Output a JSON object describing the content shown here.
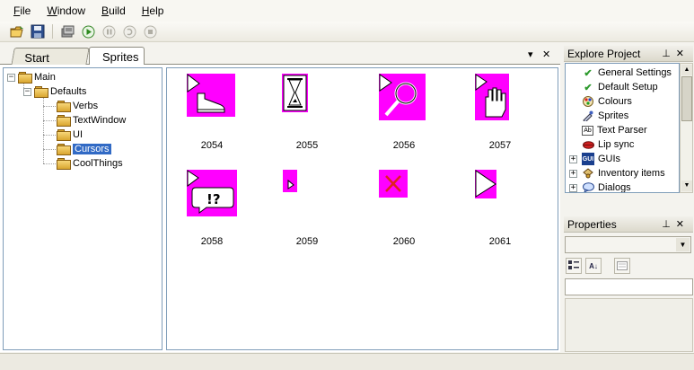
{
  "menu": {
    "items": [
      "File",
      "Window",
      "Build",
      "Help"
    ],
    "hotkeys": [
      "F",
      "W",
      "B",
      "H"
    ]
  },
  "toolbar": {
    "icons": [
      "open-folder-icon",
      "save-icon",
      "build-icon",
      "run-icon",
      "pause-icon",
      "step-icon",
      "stop-icon"
    ]
  },
  "tabs": {
    "start_page": "Start Page",
    "sprites": "Sprites",
    "dropdown_glyph": "▾",
    "close_glyph": "✕"
  },
  "tree": {
    "main": "Main",
    "defaults": "Defaults",
    "children": [
      "Verbs",
      "TextWindow",
      "UI",
      "Cursors",
      "CoolThings"
    ],
    "selected": "Cursors"
  },
  "sprites": [
    {
      "id": "2054",
      "icon": "shoe-walk-cursor-icon"
    },
    {
      "id": "2055",
      "icon": "hourglass-wait-cursor-icon"
    },
    {
      "id": "2056",
      "icon": "magnifier-look-cursor-icon"
    },
    {
      "id": "2057",
      "icon": "hand-interact-cursor-icon"
    },
    {
      "id": "2058",
      "icon": "speech-bubble-talk-cursor-icon"
    },
    {
      "id": "2059",
      "icon": "small-arrow-cursor-icon"
    },
    {
      "id": "2060",
      "icon": "red-x-cursor-icon"
    },
    {
      "id": "2061",
      "icon": "arrow-cursor-icon"
    }
  ],
  "explore": {
    "title": "Explore Project",
    "items": [
      {
        "label": "General Settings",
        "icon": "checkmark-icon",
        "expandable": false
      },
      {
        "label": "Default Setup",
        "icon": "checkmark-icon",
        "expandable": false
      },
      {
        "label": "Colours",
        "icon": "palette-icon",
        "expandable": false
      },
      {
        "label": "Sprites",
        "icon": "sprite-brush-icon",
        "expandable": false
      },
      {
        "label": "Text Parser",
        "icon": "text-parser-icon",
        "expandable": false
      },
      {
        "label": "Lip sync",
        "icon": "lips-icon",
        "expandable": false
      },
      {
        "label": "GUIs",
        "icon": "gui-icon",
        "expandable": true
      },
      {
        "label": "Inventory items",
        "icon": "inventory-icon",
        "expandable": true
      },
      {
        "label": "Dialogs",
        "icon": "dialog-icon",
        "expandable": true
      }
    ]
  },
  "properties": {
    "title": "Properties"
  },
  "colors": {
    "sprite_background": "#ff00ff",
    "selection": "#316ac5"
  }
}
